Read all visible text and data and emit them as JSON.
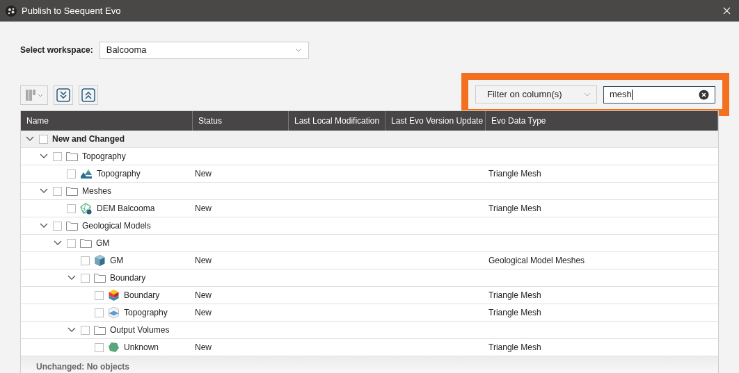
{
  "window": {
    "title": "Publish to Seequent Evo"
  },
  "workspace": {
    "label": "Select workspace:",
    "value": "Balcooma"
  },
  "filter": {
    "highlighted": true,
    "column_select": "Filter on column(s)",
    "search_value": "mesh"
  },
  "table": {
    "columns": [
      "Name",
      "Status",
      "Last Local Modification",
      "Last Evo Version Update",
      "Evo Data Type"
    ],
    "tree": [
      {
        "kind": "group",
        "name": "New and Changed",
        "checked": false,
        "expanded": true,
        "children": [
          {
            "kind": "folder",
            "name": "Topography",
            "checked": false,
            "expanded": true,
            "children": [
              {
                "kind": "topography",
                "name": "Topography",
                "checked": false,
                "status": "New",
                "data_type": "Triangle Mesh"
              }
            ]
          },
          {
            "kind": "folder",
            "name": "Meshes",
            "checked": false,
            "expanded": true,
            "children": [
              {
                "kind": "mesh",
                "name": "DEM Balcooma",
                "checked": false,
                "status": "New",
                "data_type": "Triangle Mesh"
              }
            ]
          },
          {
            "kind": "folder",
            "name": "Geological Models",
            "checked": false,
            "expanded": true,
            "children": [
              {
                "kind": "folder",
                "name": "GM",
                "checked": false,
                "expanded": true,
                "children": [
                  {
                    "kind": "geomodel",
                    "name": "GM",
                    "checked": false,
                    "status": "New",
                    "data_type": "Geological Model Meshes"
                  },
                  {
                    "kind": "folder",
                    "name": "Boundary",
                    "checked": false,
                    "expanded": true,
                    "children": [
                      {
                        "kind": "boundary",
                        "name": "Boundary",
                        "checked": false,
                        "status": "New",
                        "data_type": "Triangle Mesh"
                      },
                      {
                        "kind": "surface",
                        "name": "Topography",
                        "checked": false,
                        "status": "New",
                        "data_type": "Triangle Mesh"
                      }
                    ]
                  },
                  {
                    "kind": "folder",
                    "name": "Output Volumes",
                    "checked": false,
                    "expanded": true,
                    "children": [
                      {
                        "kind": "volume",
                        "name": "Unknown",
                        "checked": false,
                        "status": "New",
                        "data_type": "Triangle Mesh"
                      }
                    ]
                  }
                ]
              }
            ]
          }
        ]
      }
    ],
    "footer": "Unchanged: No objects"
  }
}
